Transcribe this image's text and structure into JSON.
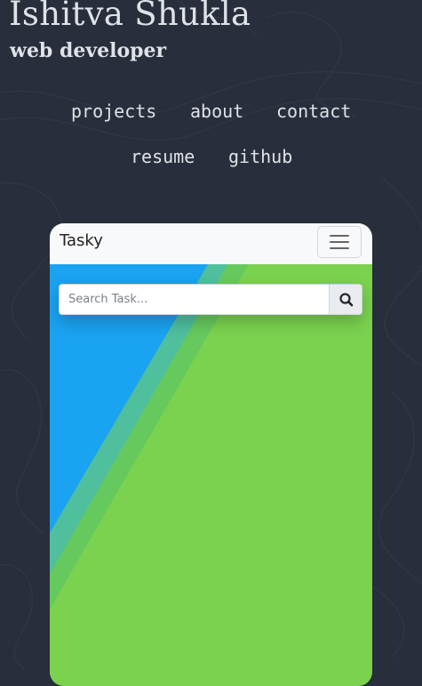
{
  "header": {
    "name": "Ishitva Shukla",
    "role": "web developer"
  },
  "nav": {
    "items": [
      "projects",
      "about",
      "contact",
      "resume",
      "github"
    ]
  },
  "preview": {
    "brand": "Tasky",
    "menu_icon": "hamburger-menu-icon",
    "search": {
      "placeholder": "Search Task...",
      "value": "",
      "button_icon": "search-icon"
    }
  },
  "colors": {
    "page_background": "#282e3b",
    "text": "#dfe2e7",
    "navbar": "#f8f9fa",
    "hero_blue": "#1aa3f1",
    "hero_teal": "#4fbf9e",
    "hero_green_light": "#66c95e",
    "hero_green": "#7bd24f"
  }
}
